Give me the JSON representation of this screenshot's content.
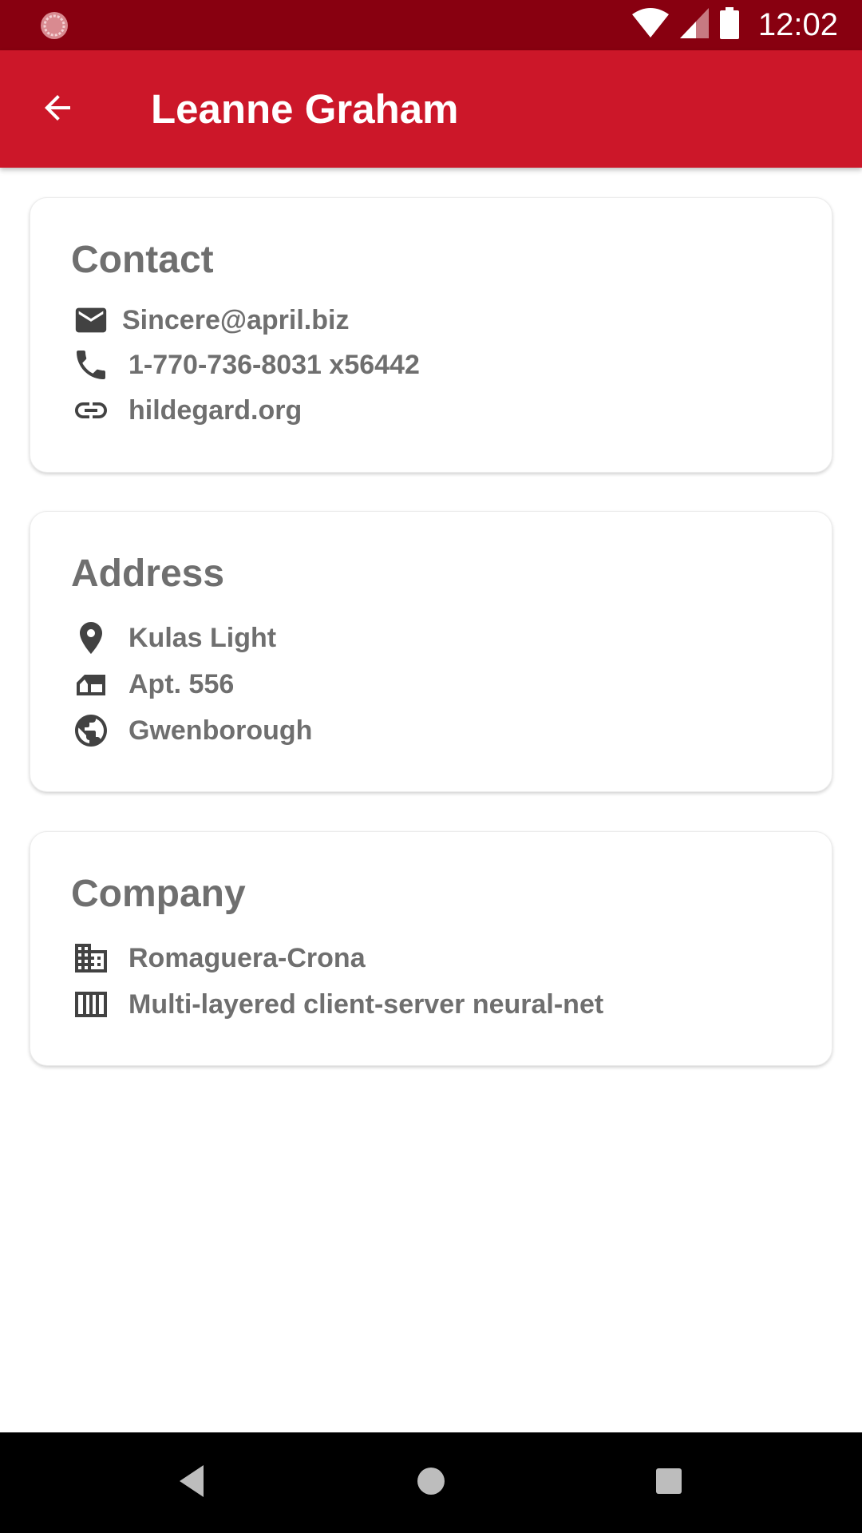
{
  "status_bar": {
    "time": "12:02"
  },
  "app_bar": {
    "title": "Leanne Graham"
  },
  "contact": {
    "title": "Contact",
    "email": "Sincere@april.biz",
    "phone": "1-770-736-8031 x56442",
    "website": "hildegard.org"
  },
  "address": {
    "title": "Address",
    "street": "Kulas Light",
    "suite": "Apt. 556",
    "city": "Gwenborough"
  },
  "company": {
    "title": "Company",
    "name": "Romaguera-Crona",
    "catch_phrase": "Multi-layered client-server neural-net"
  },
  "colors": {
    "status_bar": "#880010",
    "app_bar": "#cc1729",
    "text_muted": "#6f6f6f",
    "icon": "#424242"
  }
}
